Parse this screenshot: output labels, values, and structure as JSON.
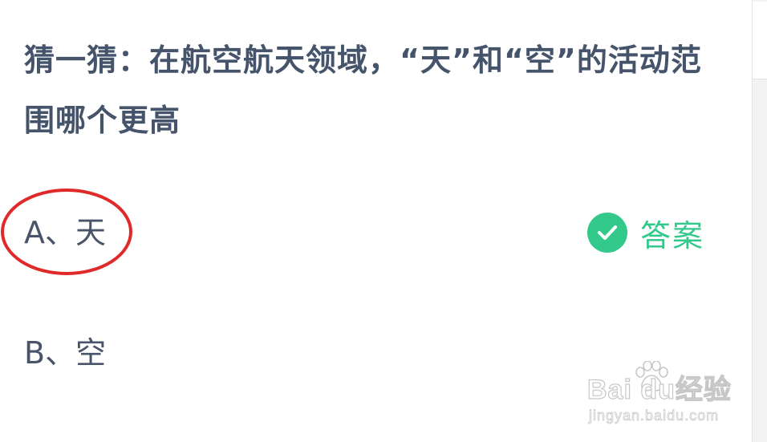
{
  "question": {
    "text": "猜一猜：在航空航天领域，“天”和“空”的活动范围哪个更高"
  },
  "options": [
    {
      "label": "A、天",
      "selected": true
    },
    {
      "label": "B、空",
      "selected": false
    }
  ],
  "answer": {
    "label": "答案",
    "icon": "check-circle-icon",
    "color": "#33c98b"
  },
  "highlight": {
    "icon": "red-circle-annotation",
    "color": "#e02a2a"
  },
  "watermark": {
    "brand": "Bai du经验",
    "url": "jingyan.baidu.com",
    "icon": "baidu-paw-icon"
  },
  "colors": {
    "question_text": "#45546b",
    "option_text": "#4a5468",
    "accent_green": "#33c98b",
    "annotation_red": "#e02a2a"
  }
}
